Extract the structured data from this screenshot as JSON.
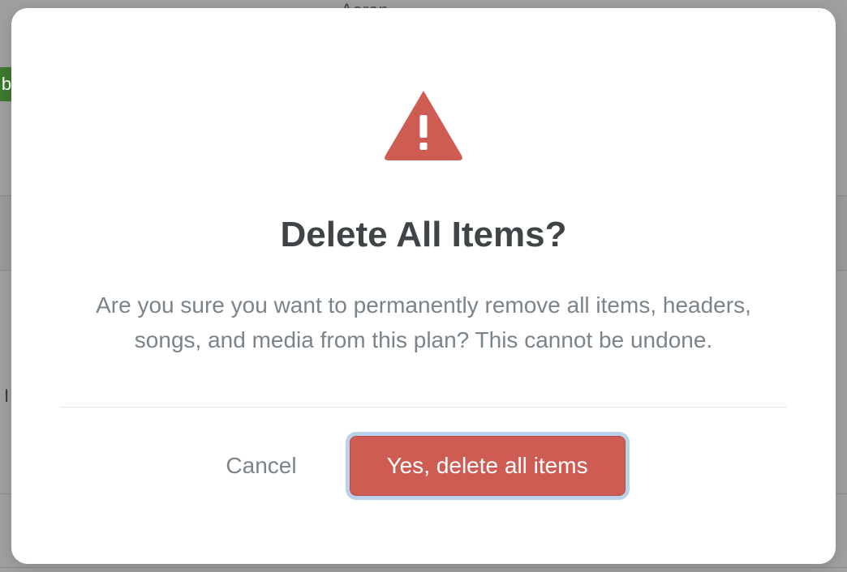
{
  "background": {
    "name_fragment": "Aaron",
    "green_fragment": "b",
    "side_fragment": "I"
  },
  "modal": {
    "title": "Delete All Items?",
    "body": "Are you sure you want to permanently remove all items, headers, songs, and media from this plan? This cannot be undone.",
    "cancel_label": "Cancel",
    "confirm_label": "Yes, delete all items"
  },
  "colors": {
    "danger": "#ce5c52",
    "focus_ring": "#b9d1ea"
  }
}
